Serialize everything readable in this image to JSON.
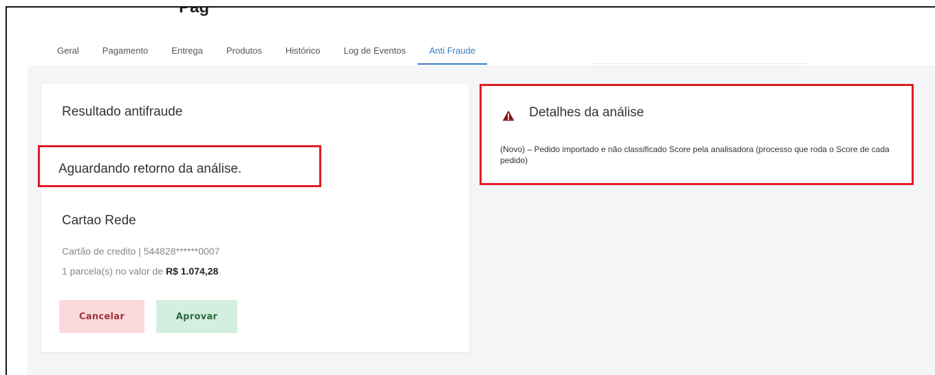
{
  "header": {
    "cut_title": "Pag"
  },
  "tabs": [
    {
      "label": "Geral",
      "active": false
    },
    {
      "label": "Pagamento",
      "active": false
    },
    {
      "label": "Entrega",
      "active": false
    },
    {
      "label": "Produtos",
      "active": false
    },
    {
      "label": "Histórico",
      "active": false
    },
    {
      "label": "Log de Eventos",
      "active": false
    },
    {
      "label": "Anti Fraude",
      "active": true
    }
  ],
  "result_card": {
    "title": "Resultado antifraude",
    "status": "Aguardando retorno da análise.",
    "card_name": "Cartao Rede",
    "card_info": "Cartão de credito | 544828******0007",
    "installments_prefix": "1 parcela(s) no valor de ",
    "installments_value": "R$ 1.074,28",
    "cancel_label": "Cancelar",
    "approve_label": "Aprovar"
  },
  "details_card": {
    "icon": "warning-icon",
    "title": "Detalhes da análise",
    "text": "(Novo) – Pedido importado e não classificado Score pela analisadora (processo que roda o Score de cada pedido)"
  },
  "colors": {
    "accent": "#3a7bbf",
    "highlight": "#e01b24",
    "cancel_bg": "#fadadd",
    "approve_bg": "#d4efdf",
    "warning": "#8b1a1a"
  }
}
